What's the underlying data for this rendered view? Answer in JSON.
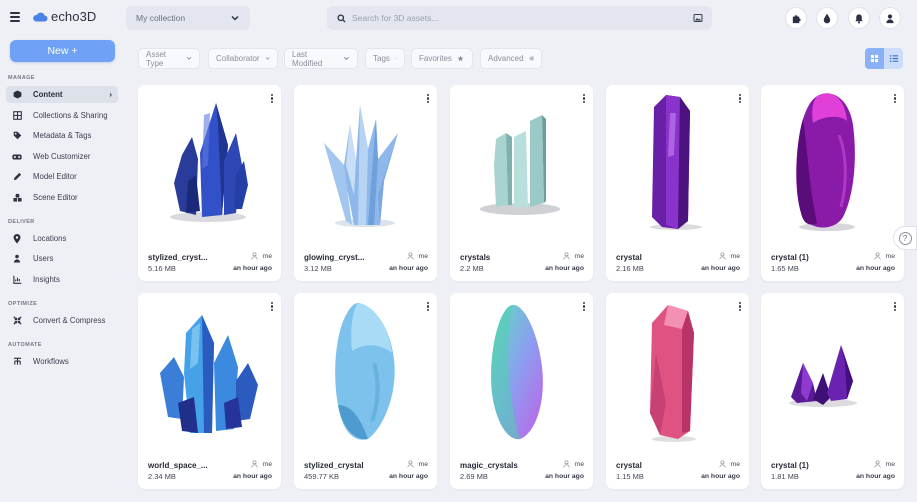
{
  "app": {
    "logo_text": "echo3D"
  },
  "header": {
    "collection_select": "My collection",
    "search_placeholder": "Search for 3D assets...",
    "icons": [
      "puzzle-icon",
      "droplet-icon",
      "bell-icon",
      "user-icon"
    ]
  },
  "sidebar": {
    "new_button": "New +",
    "sections": [
      {
        "title": "MANAGE",
        "items": [
          "Content",
          "Collections & Sharing",
          "Metadata & Tags",
          "Web Customizer",
          "Model Editor",
          "Scene Editor"
        ]
      },
      {
        "title": "DELIVER",
        "items": [
          "Locations",
          "Users",
          "Insights"
        ]
      },
      {
        "title": "OPTIMIZE",
        "items": [
          "Convert & Compress"
        ]
      },
      {
        "title": "AUTOMATE",
        "items": [
          "Workflows"
        ]
      }
    ],
    "active_item": "Content",
    "active_caret": "›"
  },
  "filters": [
    "Asset Type",
    "Collaborator",
    "Last Modified",
    "Tags",
    "Favorites",
    "Advanced"
  ],
  "assets": [
    {
      "name": "stylized_cryst...",
      "size": "5.16 MB",
      "owner": "me",
      "time": "an hour ago"
    },
    {
      "name": "glowing_cryst...",
      "size": "3.12 MB",
      "owner": "me",
      "time": "an hour ago"
    },
    {
      "name": "crystals",
      "size": "2.2 MB",
      "owner": "me",
      "time": "an hour ago"
    },
    {
      "name": "crystal",
      "size": "2.16 MB",
      "owner": "me",
      "time": "an hour ago"
    },
    {
      "name": "crystal (1)",
      "size": "1.65 MB",
      "owner": "me",
      "time": "an hour ago"
    },
    {
      "name": "world_space_...",
      "size": "2.34 MB",
      "owner": "me",
      "time": "an hour ago"
    },
    {
      "name": "stylized_crystal",
      "size": "459.77 KB",
      "owner": "me",
      "time": "an hour ago"
    },
    {
      "name": "magic_crystals",
      "size": "2.69 MB",
      "owner": "me",
      "time": "an hour ago"
    },
    {
      "name": "crystal",
      "size": "1.15 MB",
      "owner": "me",
      "time": "an hour ago"
    },
    {
      "name": "crystal (1)",
      "size": "1.81 MB",
      "owner": "me",
      "time": "an hour ago"
    }
  ],
  "help_label": "?",
  "colors": {
    "accent": "#6fa2f7",
    "background": "#eef0f6",
    "card": "#ffffff"
  }
}
